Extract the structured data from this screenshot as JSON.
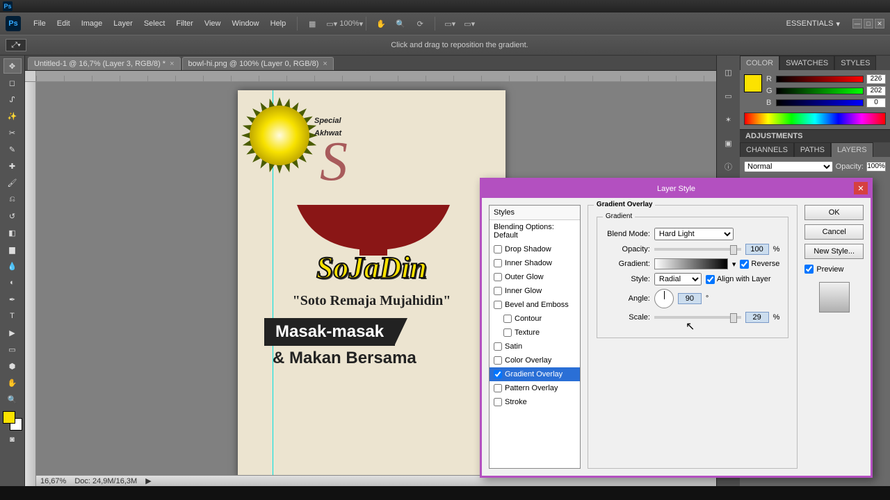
{
  "titlebar": {},
  "menu": {
    "items": [
      "File",
      "Edit",
      "Image",
      "Layer",
      "Select",
      "Filter",
      "View",
      "Window",
      "Help"
    ],
    "zoom_pct": "100%",
    "workspace": "ESSENTIALS"
  },
  "optionsbar": {
    "hint": "Click and drag to reposition the gradient."
  },
  "tabs": [
    {
      "label": "Untitled-1 @ 16,7% (Layer 3, RGB/8) *",
      "active": true
    },
    {
      "label": "bowl-hi.png @ 100% (Layer 0, RGB/8)",
      "active": false
    }
  ],
  "artwork": {
    "special_line1": "Special",
    "special_line2": "Akhwat",
    "logo_main": "SoJaDin",
    "logo_sub": "\"Soto Remaja Mujahidin\"",
    "banner": "Masak-masak",
    "line2": "& Makan Bersama"
  },
  "statusbar": {
    "zoom": "16,67%",
    "docinfo": "Doc: 24,9M/16,3M"
  },
  "panels": {
    "color_tabs": [
      "COLOR",
      "SWATCHES",
      "STYLES"
    ],
    "r": "226",
    "g": "202",
    "b": "0",
    "adjust": "ADJUSTMENTS",
    "layer_tabs": [
      "CHANNELS",
      "PATHS",
      "LAYERS"
    ],
    "blend_mode": "Normal",
    "opacity_label": "Opacity:",
    "opacity_value": "100%"
  },
  "dialog": {
    "title": "Layer Style",
    "styles_head": "Styles",
    "styles": [
      {
        "label": "Blending Options: Default",
        "checkbox": false,
        "indent": false,
        "class": "default"
      },
      {
        "label": "Drop Shadow",
        "checkbox": true,
        "checked": false
      },
      {
        "label": "Inner Shadow",
        "checkbox": true,
        "checked": false
      },
      {
        "label": "Outer Glow",
        "checkbox": true,
        "checked": false
      },
      {
        "label": "Inner Glow",
        "checkbox": true,
        "checked": false
      },
      {
        "label": "Bevel and Emboss",
        "checkbox": true,
        "checked": false
      },
      {
        "label": "Contour",
        "checkbox": true,
        "checked": false,
        "indent": true
      },
      {
        "label": "Texture",
        "checkbox": true,
        "checked": false,
        "indent": true
      },
      {
        "label": "Satin",
        "checkbox": true,
        "checked": false
      },
      {
        "label": "Color Overlay",
        "checkbox": true,
        "checked": false
      },
      {
        "label": "Gradient Overlay",
        "checkbox": true,
        "checked": true,
        "active": true
      },
      {
        "label": "Pattern Overlay",
        "checkbox": true,
        "checked": false
      },
      {
        "label": "Stroke",
        "checkbox": true,
        "checked": false
      }
    ],
    "section_title": "Gradient Overlay",
    "group_title": "Gradient",
    "blend_mode_lbl": "Blend Mode:",
    "blend_mode": "Hard Light",
    "opacity_lbl": "Opacity:",
    "opacity": "100",
    "pct": "%",
    "gradient_lbl": "Gradient:",
    "reverse_lbl": "Reverse",
    "style_lbl": "Style:",
    "style": "Radial",
    "align_lbl": "Align with Layer",
    "angle_lbl": "Angle:",
    "angle": "90",
    "deg": "°",
    "scale_lbl": "Scale:",
    "scale": "29",
    "buttons": {
      "ok": "OK",
      "cancel": "Cancel",
      "newstyle": "New Style..."
    },
    "preview_lbl": "Preview"
  }
}
